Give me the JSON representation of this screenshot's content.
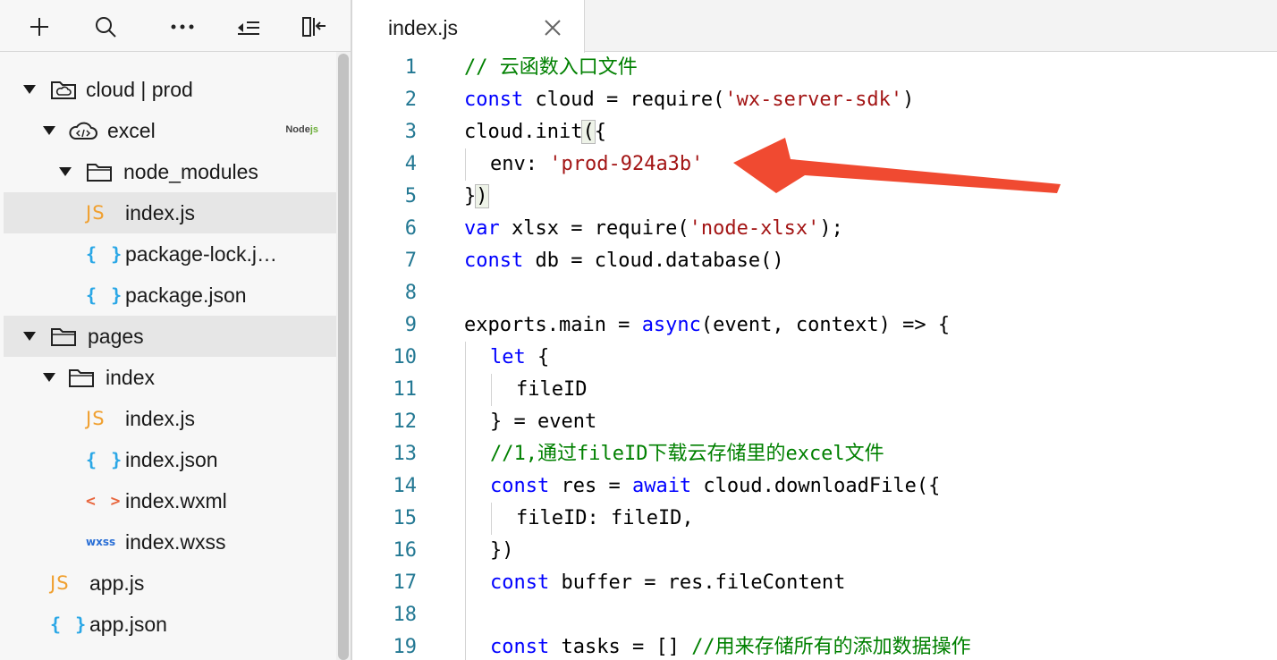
{
  "sidebar": {
    "toolbar": {
      "add": "add-icon",
      "search": "search-icon",
      "more": "more-icon",
      "collapse": "collapse-all-icon",
      "split": "split-panel-icon"
    },
    "tree": [
      {
        "label": "cloud | prod",
        "icon": "cloud-folder-icon"
      },
      {
        "label": "excel",
        "icon": "cloud-function-icon",
        "badge_a": "Node",
        "badge_b": "js"
      },
      {
        "label": "node_modules",
        "icon": "folder-icon"
      },
      {
        "label": "index.js",
        "icon_text": "JS",
        "selected": true
      },
      {
        "label": "package-lock.j…",
        "icon_text": "{ }"
      },
      {
        "label": "package.json",
        "icon_text": "{ }"
      },
      {
        "label": "pages",
        "icon": "folder-icon"
      },
      {
        "label": "index",
        "icon": "folder-icon"
      },
      {
        "label": "index.js",
        "icon_text": "JS"
      },
      {
        "label": "index.json",
        "icon_text": "{ }"
      },
      {
        "label": "index.wxml",
        "icon_text": "< >"
      },
      {
        "label": "index.wxss",
        "icon_text": "wxss"
      },
      {
        "label": "app.js",
        "icon_text": "JS"
      },
      {
        "label": "app.json",
        "icon_text": "{ }"
      }
    ]
  },
  "editor": {
    "tab": {
      "title": "index.js",
      "close": "close-icon"
    },
    "line_numbers": [
      "1",
      "2",
      "3",
      "4",
      "5",
      "6",
      "7",
      "8",
      "9",
      "10",
      "11",
      "12",
      "13",
      "14",
      "15",
      "16",
      "17",
      "18",
      "19"
    ],
    "code": {
      "l1_comment": "// 云函数入口文件",
      "l2_kw": "const",
      "l2_mid": " cloud = require(",
      "l2_str": "'wx-server-sdk'",
      "l2_end": ")",
      "l3_a": "cloud.init",
      "l3_b": "(",
      "l3_c": "{",
      "l4_key": "env: ",
      "l4_str": "'prod-924a3b'",
      "l5_a": "}",
      "l5_b": ")",
      "l6_kw": "var",
      "l6_mid": " xlsx = require(",
      "l6_str": "'node-xlsx'",
      "l6_end": ");",
      "l7_kw": "const",
      "l7_rest": " db = cloud.database()",
      "l9_a": "exports.main = ",
      "l9_kw": "async",
      "l9_b": "(event, context) => {",
      "l10_kw": "let",
      "l10_rest": " {",
      "l11": "fileID",
      "l12": "} = event",
      "l13_comment": "//1,通过fileID下载云存储里的excel文件",
      "l14_kw": "const",
      "l14_a": " res = ",
      "l14_kw2": "await",
      "l14_b": " cloud.downloadFile({",
      "l15": "fileID: fileID,",
      "l16": "})",
      "l17_kw": "const",
      "l17_rest": " buffer = res.fileContent",
      "l19_kw": "const",
      "l19_rest": " tasks = [] ",
      "l19_comment": "//用来存储所有的添加数据操作"
    }
  },
  "annotation": {
    "arrow_color": "#f04a31"
  }
}
